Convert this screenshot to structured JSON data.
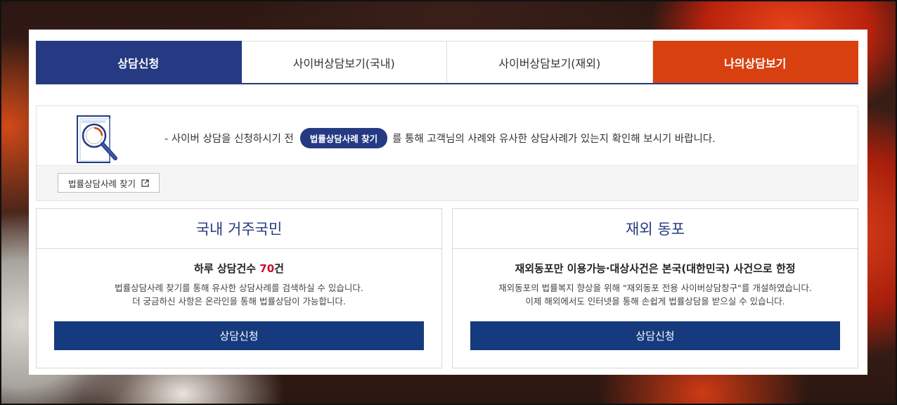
{
  "tabs": [
    {
      "label": "상담신청",
      "state": "active"
    },
    {
      "label": "사이버상담보기(국내)",
      "state": "normal"
    },
    {
      "label": "사이버상담보기(재외)",
      "state": "normal"
    },
    {
      "label": "나의상담보기",
      "state": "highlight"
    }
  ],
  "info": {
    "icon": "magnifier-document-icon",
    "text_before": "- 사이버 상담을 신청하시기 전",
    "pill_label": "법률상담사례 찾기",
    "text_after": "를 통해 고객님의 사례와 유사한 상담사례가 있는지 확인해 보시기 바랍니다.",
    "find_button_label": "법률상담사례 찾기",
    "find_button_icon": "external-link-icon"
  },
  "cards": {
    "domestic": {
      "title": "국내 거주국민",
      "sub_prefix": "하루 상담건수 ",
      "sub_count": "70",
      "sub_suffix": "건",
      "desc_line1": "법률상담사례 찾기를 통해 유사한 상담사례를 검색하실 수 있습니다.",
      "desc_line2": "더 궁금하신 사항은 온라인을 통해 법률상담이 가능합니다.",
      "button_label": "상담신청"
    },
    "overseas": {
      "title": "재외 동포",
      "sub": "재외동포만 이용가능·대상사건은 본국(대한민국) 사건으로 한정",
      "desc_line1": "재외동포의 법률복지 향상을 위해 \"재외동포 전용 사이버상담창구\"를 개설하였습니다.",
      "desc_line2": "이제 해외에서도 인터넷을 통해 손쉽게 법률상담을 받으실 수 있습니다.",
      "button_label": "상담신청"
    }
  },
  "colors": {
    "navy": "#253a82",
    "button_navy": "#163a7e",
    "orange": "#d9400f",
    "count_red": "#c8102e"
  }
}
